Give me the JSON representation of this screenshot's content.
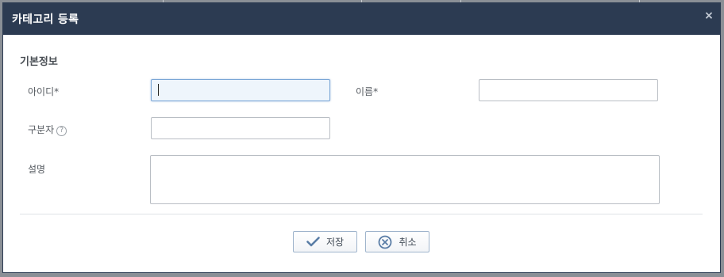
{
  "dialog": {
    "title": "카테고리 등록",
    "close_label": "×"
  },
  "form": {
    "section_title": "기본정보",
    "id_label": "아이디*",
    "name_label": "이름*",
    "separator_label": "구분자",
    "help_icon": "?",
    "description_label": "설명",
    "id_value": "",
    "name_value": "",
    "separator_value": "",
    "description_value": ""
  },
  "buttons": {
    "save_label": "저장",
    "cancel_label": "취소"
  },
  "colors": {
    "titlebar": "#2c3b52",
    "focus_border": "#7aa6d6",
    "button_border": "#9fb4cc",
    "icon": "#5a7da6"
  },
  "icons": {
    "save": "check-icon",
    "cancel": "cancel-circle-icon",
    "help": "question-circle-icon"
  }
}
